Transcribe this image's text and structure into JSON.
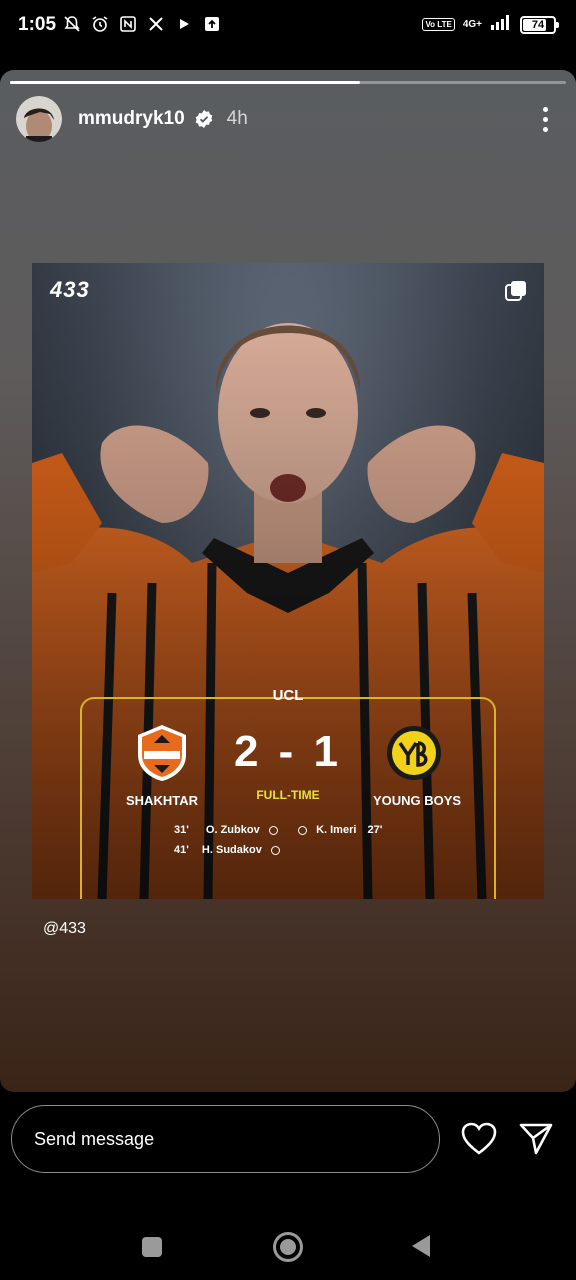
{
  "status_bar": {
    "time": "1:05",
    "icons": [
      "notifications-off-icon",
      "alarm-icon",
      "nfc-icon",
      "x-app-icon",
      "play-icon",
      "upload-icon"
    ],
    "volte": "Vo LTE",
    "network": "4G+",
    "battery": "74"
  },
  "story": {
    "progress": 0.63,
    "username": "mmudryk10",
    "verified": true,
    "time_ago": "4h",
    "credit": "@433",
    "post": {
      "brand": "433",
      "competition": "UCL",
      "home_team": "SHAKHTAR",
      "away_team": "YOUNG BOYS",
      "score": "2 - 1",
      "status": "FULL-TIME",
      "home_scorers": [
        {
          "minute": "31'",
          "name": "O. Zubkov"
        },
        {
          "minute": "41'",
          "name": "H. Sudakov"
        }
      ],
      "away_scorers": [
        {
          "minute": "27'",
          "name": "K. Imeri"
        }
      ]
    }
  },
  "reply": {
    "placeholder": "Send message"
  },
  "colors": {
    "accent_gold": "#d9b426",
    "fulltime_yellow": "#e8e23a",
    "shakhtar_orange": "#e86a1c",
    "young_boys_yellow": "#f2d11b"
  }
}
